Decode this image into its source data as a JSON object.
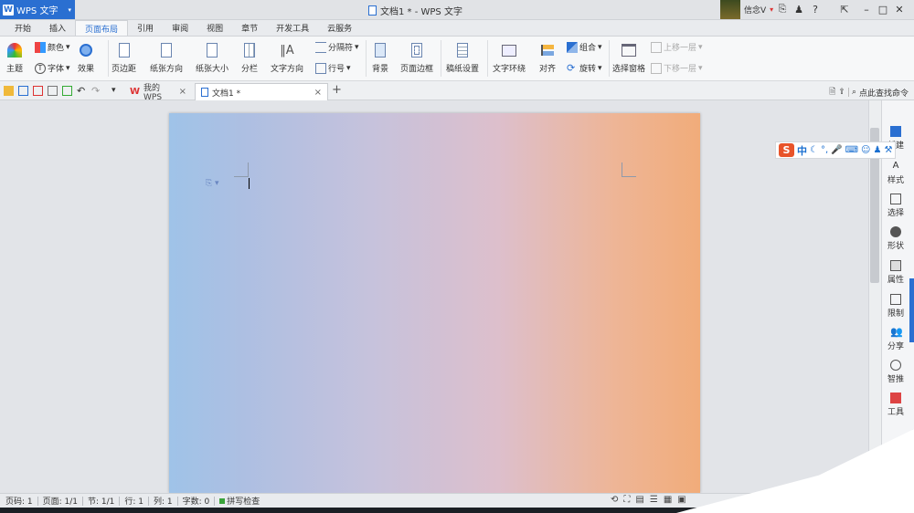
{
  "app": {
    "name": "WPS 文字",
    "doc_title": "文档1 * - WPS 文字",
    "user_name": "信念V"
  },
  "menu_tabs": [
    "开始",
    "插入",
    "页面布局",
    "引用",
    "审阅",
    "视图",
    "章节",
    "开发工具",
    "云服务"
  ],
  "ribbon": {
    "theme": "主题",
    "colors": "颜色",
    "font": "字体",
    "effects": "效果",
    "margins": "页边距",
    "orientation": "纸张方向",
    "size": "纸张大小",
    "columns": "分栏",
    "text_direction": "文字方向",
    "breaks": "分隔符",
    "line_numbers": "行号",
    "background": "背景",
    "page_border": "页面边框",
    "manuscript": "稿纸设置",
    "text_wrap": "文字环绕",
    "align": "对齐",
    "group": "组合",
    "rotate": "旋转",
    "selection_pane": "选择窗格",
    "bring_forward": "上移一层",
    "send_backward": "下移一层"
  },
  "doc_tabs": [
    {
      "label": "我的WPS"
    },
    {
      "label": "文档1 *"
    }
  ],
  "search_cmd": "点此查找命令",
  "sidebar": [
    "新建",
    "样式",
    "选择",
    "形状",
    "属性",
    "限制",
    "分享",
    "智推",
    "工具"
  ],
  "ime": {
    "mode": "中"
  },
  "status": {
    "page_num": "页码: 1",
    "pages": "页面: 1/1",
    "section": "节: 1/1",
    "row": "行: 1",
    "col": "列: 1",
    "words": "字数: 0",
    "spell": "拼写检查"
  },
  "colors": {
    "accent": "#2a6fd1",
    "page_gradient_start": "#9fc3e8",
    "page_gradient_end": "#f1ac7a"
  }
}
